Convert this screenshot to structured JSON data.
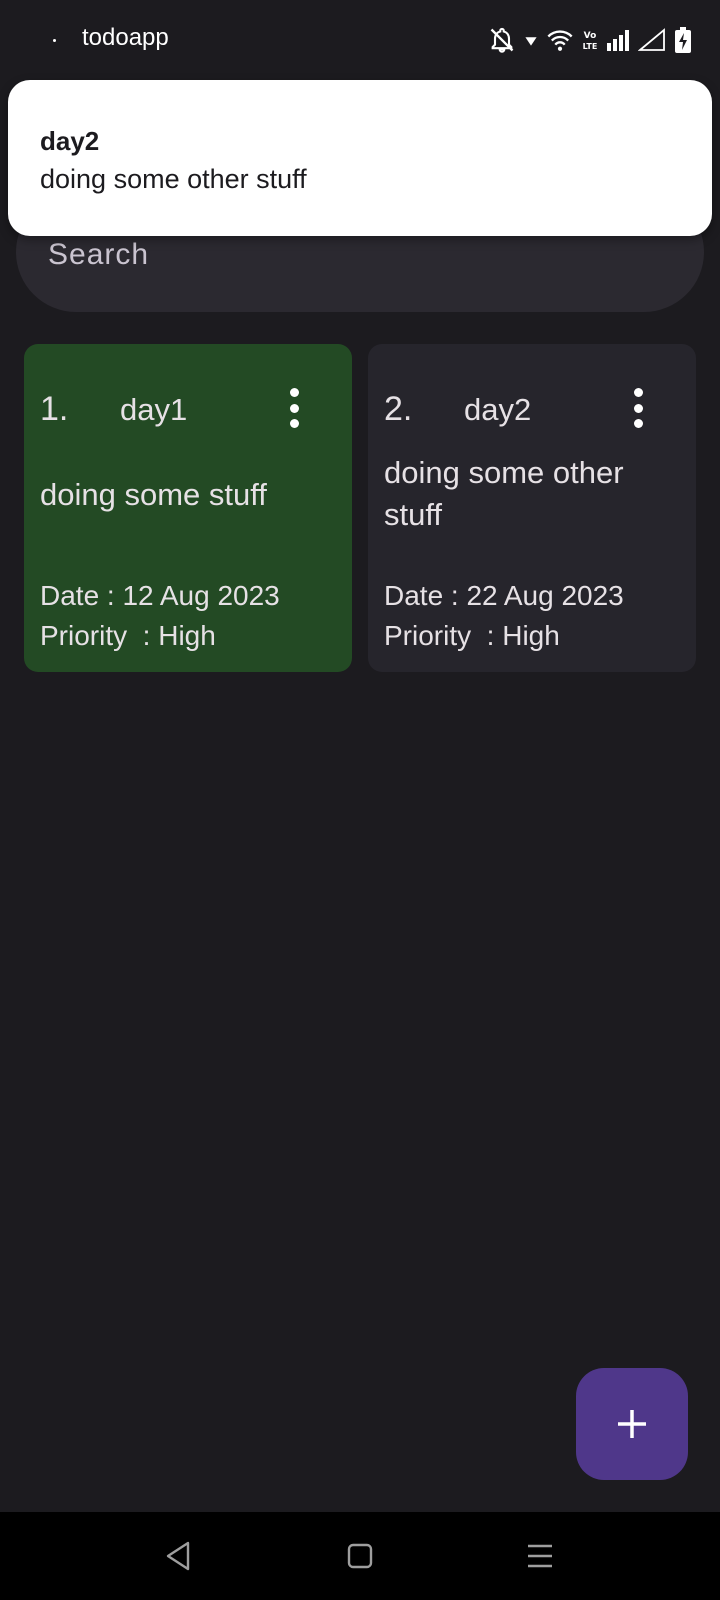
{
  "status_bar": {
    "app_name": "todoapp",
    "icons": [
      "notifications-off-icon",
      "wifi-icon",
      "volte-icon",
      "signal-icon",
      "signal-empty-icon",
      "battery-charging-icon"
    ],
    "volte_label": "Vo LTE"
  },
  "notification": {
    "title": "day2",
    "body": "doing some other stuff"
  },
  "search": {
    "placeholder": "Search"
  },
  "todos": [
    {
      "number": "1.",
      "title": "day1",
      "description": "doing some stuff",
      "date": "Date : 12 Aug 2023",
      "priority": "Priority  : High",
      "color": "#234a24"
    },
    {
      "number": "2.",
      "title": "day2",
      "description": "doing some other stuff",
      "date": "Date : 22 Aug 2023",
      "priority": "Priority  : High",
      "color": "#26252c"
    }
  ],
  "fab": {
    "icon": "plus-icon",
    "color": "#4f378a"
  },
  "nav_bar": {
    "buttons": [
      "back-icon",
      "home-icon",
      "recents-icon"
    ]
  },
  "colors": {
    "background": "#1c1b1f",
    "search_background": "#2b2930"
  }
}
